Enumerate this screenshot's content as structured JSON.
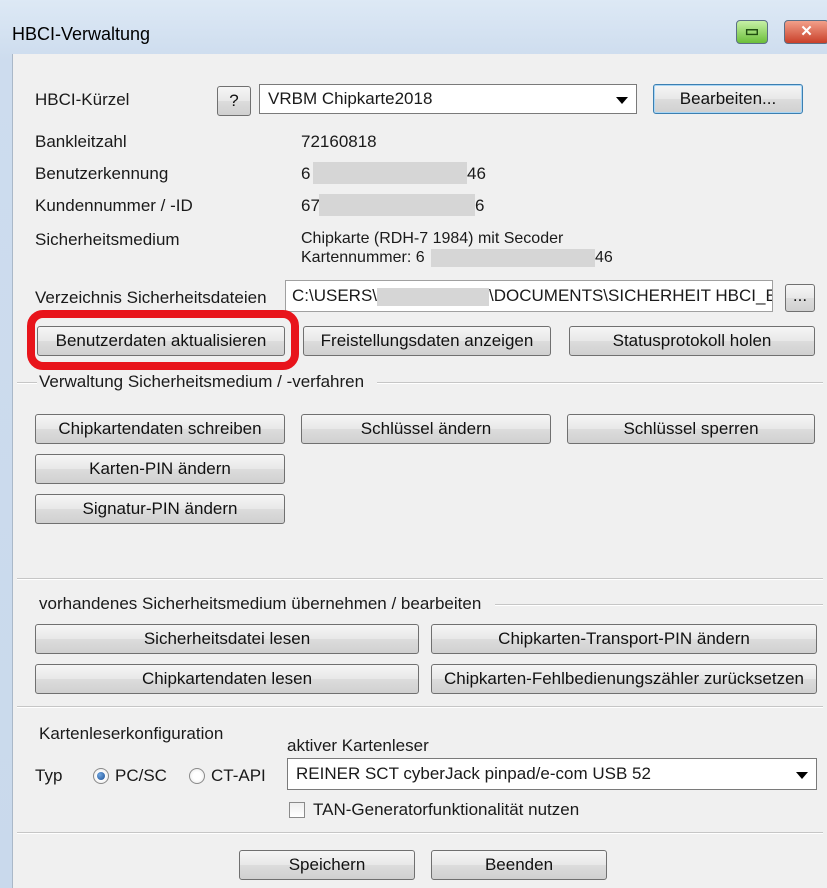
{
  "window": {
    "title": "HBCI-Verwaltung",
    "minimize_icon": "restore-icon",
    "close_icon": "close-icon",
    "close_glyph": "✕",
    "restore_glyph": "▭"
  },
  "hbci": {
    "kuerzel_label": "HBCI-Kürzel",
    "help_label": "?",
    "selected": "VRBM Chipkarte2018",
    "edit_label": "Bearbeiten..."
  },
  "info": {
    "blz_label": "Bankleitzahl",
    "blz_value": "72160818",
    "user_label": "Benutzerkennung",
    "user_value_start": "6",
    "user_value_end": "46",
    "customer_label": "Kundennummer / -ID",
    "customer_value_start": "67",
    "customer_value_end": "6",
    "medium_label": "Sicherheitsmedium",
    "medium_value": "Chipkarte  (RDH-7  1984)  mit Secoder",
    "card_number_label": "Kartennummer: 6",
    "card_number_end": "46"
  },
  "directory": {
    "label": "Verzeichnis Sicherheitsdateien",
    "path_start": "C:\\USERS\\",
    "path_end": "\\DOCUMENTS\\SICHERHEIT HBCI_E",
    "browse_label": "..."
  },
  "actions": {
    "update_user_data": "Benutzerdaten aktualisieren",
    "show_exemption": "Freistellungsdaten anzeigen",
    "get_status_log": "Statusprotokoll holen"
  },
  "security_medium_group": {
    "title": "Verwaltung Sicherheitsmedium / -verfahren",
    "write_card": "Chipkartendaten schreiben",
    "change_key": "Schlüssel ändern",
    "lock_key": "Schlüssel sperren",
    "change_card_pin": "Karten-PIN ändern",
    "change_signature_pin": "Signatur-PIN ändern"
  },
  "existing_medium_group": {
    "title": "vorhandenes Sicherheitsmedium übernehmen / bearbeiten",
    "read_security_file": "Sicherheitsdatei lesen",
    "change_transport_pin": "Chipkarten-Transport-PIN ändern",
    "read_card_data": "Chipkartendaten lesen",
    "reset_error_counter": "Chipkarten-Fehlbedienungszähler zurücksetzen"
  },
  "reader_config": {
    "title": "Kartenleserkonfiguration",
    "type_label": "Typ",
    "pcsc_label": "PC/SC",
    "ctapi_label": "CT-API",
    "selected_type": "PC/SC",
    "active_reader_label": "aktiver Kartenleser",
    "active_reader": "REINER SCT cyberJack pinpad/e-com USB 52",
    "tan_generator_label": "TAN-Generatorfunktionalität nutzen",
    "tan_generator_checked": false
  },
  "footer": {
    "save_label": "Speichern",
    "exit_label": "Beenden"
  },
  "colors": {
    "highlight": "#e8141b",
    "window_frame": "#cddcee",
    "client_bg": "#f0f0f0"
  }
}
